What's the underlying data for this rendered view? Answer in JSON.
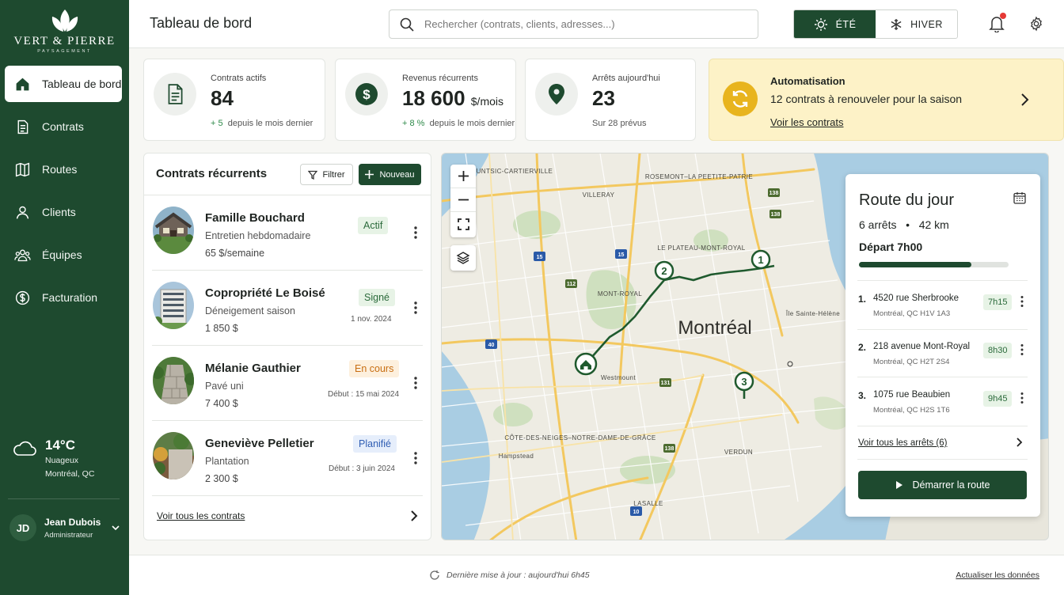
{
  "brand": {
    "name": "VERT & PIERRE",
    "tagline": "PAYSAGEMENT"
  },
  "nav": [
    {
      "label": "Tableau de bord",
      "icon": "home-icon",
      "active": true
    },
    {
      "label": "Contrats",
      "icon": "document-icon"
    },
    {
      "label": "Routes",
      "icon": "map-icon"
    },
    {
      "label": "Clients",
      "icon": "user-icon"
    },
    {
      "label": "Équipes",
      "icon": "team-icon"
    },
    {
      "label": "Facturation",
      "icon": "dollar-icon"
    }
  ],
  "weather": {
    "temp": "14°C",
    "condition": "Nuageux",
    "location": "Montréal, QC"
  },
  "user": {
    "initials": "JD",
    "name": "Jean Dubois",
    "role": "Administrateur"
  },
  "header": {
    "title": "Tableau de bord",
    "search_placeholder": "Rechercher (contrats, clients, adresses...)",
    "season_summer": "ÉTÉ",
    "season_winter": "HIVER",
    "active_season": "summer"
  },
  "kpis": {
    "active": {
      "label": "Contrats actifs",
      "value": "84",
      "delta": "+ 5",
      "delta_text": "depuis le mois dernier"
    },
    "revenue": {
      "label": "Revenus récurrents",
      "value": "18 600",
      "unit": "$/mois",
      "delta": "+ 8 %",
      "delta_text": "depuis le mois dernier"
    },
    "stops": {
      "label": "Arrêts aujourd'hui",
      "value": "23",
      "sub": "Sur 28 prévus"
    }
  },
  "automation": {
    "title": "Automatisation",
    "description": "12 contrats à renouveler pour la saison",
    "link": "Voir les contrats"
  },
  "contracts": {
    "title": "Contrats récurrents",
    "filter": "Filtrer",
    "new": "Nouveau",
    "rows": [
      {
        "name": "Famille Bouchard",
        "service": "Entretien hebdomadaire",
        "price": "65 $/semaine",
        "status": "Actif",
        "date": ""
      },
      {
        "name": "Copropriété Le Boisé",
        "service": "Déneigement saison",
        "price": "1 850 $",
        "status": "Signé",
        "date": "1 nov. 2024"
      },
      {
        "name": "Mélanie Gauthier",
        "service": "Pavé uni",
        "price": "7 400 $",
        "status": "En cours",
        "date": "Début : 15 mai 2024"
      },
      {
        "name": "Geneviève Pelletier",
        "service": "Plantation",
        "price": "2 300 $",
        "status": "Planifié",
        "date": "Début : 3 juin 2024"
      }
    ],
    "footer": "Voir tous les contrats"
  },
  "map": {
    "city": "Montréal",
    "labels": [
      "AHUNTSIC-CARTIERVILLE",
      "VILLERAY",
      "ROSEMONT–LA PEETITE-PATRIE",
      "LE PLATEAU-MONT-ROYAL",
      "MONT-ROYAL",
      "Westmount",
      "CÔTE-DES-NEIGES–NOTRE-DAME-DE-GRÂCE",
      "Hampstead",
      "VERDUN",
      "LASALLE",
      "Île Sainte-Hélène"
    ],
    "markers": [
      "1",
      "2",
      "3"
    ]
  },
  "route": {
    "title": "Route du jour",
    "stops_count": "6 arrêts",
    "distance": "42 km",
    "departure": "Départ 7h00",
    "progress": 0.75,
    "stops": [
      {
        "num": "1.",
        "address": "4520 rue Sherbrooke",
        "city": "Montréal, QC  H1V 1A3",
        "time": "7h15"
      },
      {
        "num": "2.",
        "address": "218 avenue Mont-Royal",
        "city": "Montréal, QC  H2T 2S4",
        "time": "8h30"
      },
      {
        "num": "3.",
        "address": "1075 rue Beaubien",
        "city": "Montréal, QC  H2S 1T6",
        "time": "9h45"
      }
    ],
    "all_stops": "Voir tous les arrêts (6)",
    "start": "Démarrer la route"
  },
  "footer": {
    "updated": "Dernière mise à jour : aujourd'hui 6h45",
    "refresh": "Actualiser les données"
  },
  "colors": {
    "primary": "#1e4a2f",
    "accent": "#e8b41e",
    "success": "#2f8a4a"
  }
}
